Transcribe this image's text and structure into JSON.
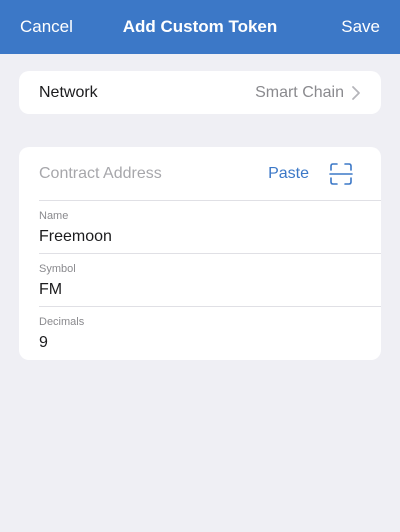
{
  "nav": {
    "cancel_label": "Cancel",
    "title": "Add Custom Token",
    "save_label": "Save"
  },
  "network": {
    "label": "Network",
    "value": "Smart Chain"
  },
  "contract": {
    "placeholder": "Contract Address",
    "paste_label": "Paste",
    "scan_icon": "qr-scan-icon"
  },
  "fields": {
    "name": {
      "label": "Name",
      "value": "Freemoon"
    },
    "symbol": {
      "label": "Symbol",
      "value": "FM"
    },
    "decimals": {
      "label": "Decimals",
      "value": "9"
    }
  },
  "colors": {
    "accent": "#3c78c7",
    "background": "#efeff4",
    "card": "#ffffff",
    "secondary_text": "#8a8a8e"
  }
}
